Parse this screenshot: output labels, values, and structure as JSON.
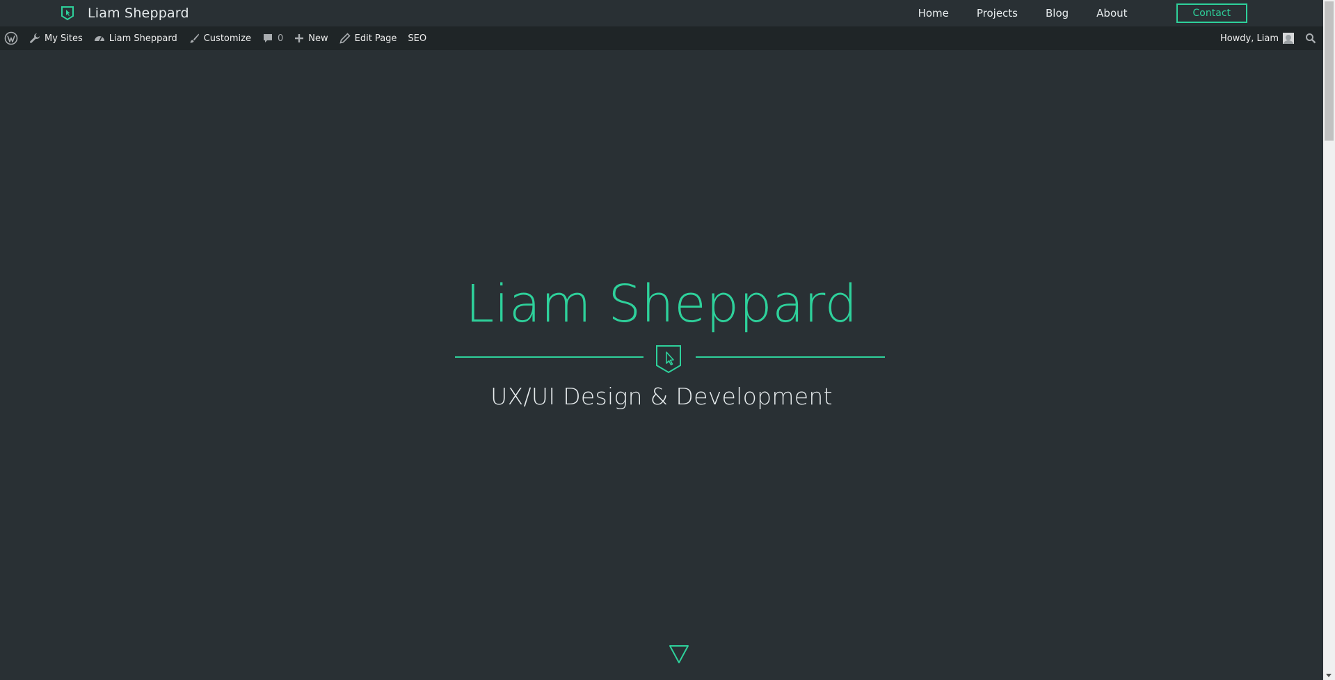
{
  "site": {
    "brand_name": "Liam Sheppard",
    "accent_color": "#2ed19b",
    "background_color": "#293034"
  },
  "nav": {
    "items": [
      {
        "label": "Home"
      },
      {
        "label": "Projects"
      },
      {
        "label": "Blog"
      },
      {
        "label": "About"
      }
    ],
    "contact_label": "Contact"
  },
  "admin_bar": {
    "wp_icon": "wordpress-logo-icon",
    "my_sites": "My Sites",
    "site_name": "Liam Sheppard",
    "customize": "Customize",
    "comments_count": "0",
    "new": "New",
    "edit_page": "Edit Page",
    "seo": "SEO",
    "howdy": "Howdy, Liam",
    "search_icon": "search-icon"
  },
  "hero": {
    "title": "Liam Sheppard",
    "subtitle": "UX/UI Design & Development",
    "badge_icon": "cursor-shield-icon",
    "scroll_icon": "down-triangle-icon"
  }
}
